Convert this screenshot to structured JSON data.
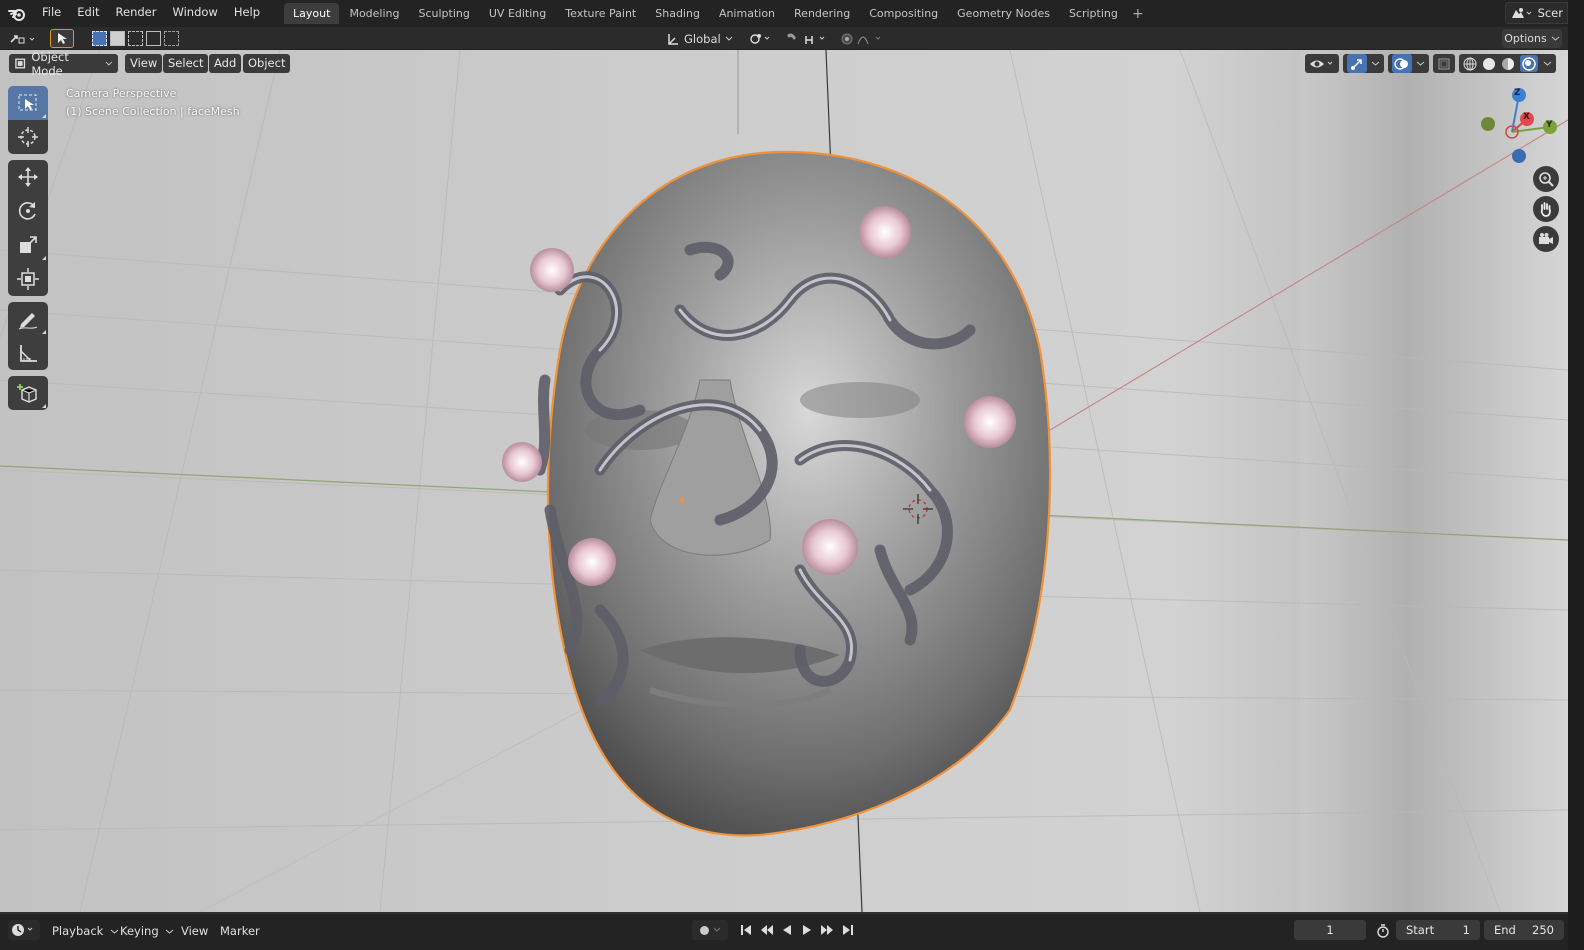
{
  "topbar": {
    "menus": [
      "File",
      "Edit",
      "Render",
      "Window",
      "Help"
    ],
    "workspaces": [
      "Layout",
      "Modeling",
      "Sculpting",
      "UV Editing",
      "Texture Paint",
      "Shading",
      "Animation",
      "Rendering",
      "Compositing",
      "Geometry Nodes",
      "Scripting"
    ],
    "active_workspace": "Layout",
    "scene_label": "Scer"
  },
  "header": {
    "orientation": "Global",
    "options": "Options"
  },
  "viewport": {
    "mode": "Object Mode",
    "menus": [
      "View",
      "Select",
      "Add",
      "Object"
    ],
    "info_line1": "Camera Perspective",
    "info_line2": "(1) Scene Collection | faceMesh",
    "axes": {
      "z": "Z",
      "x": "X",
      "y": "Y"
    },
    "colors": {
      "selection_outline": "#f0923a",
      "active_tool": "#5676a5",
      "x_axis": "#cc4a4a",
      "y_axis": "#7ba23a",
      "z_axis": "#3f7fd0"
    }
  },
  "tools": [
    "select-box",
    "cursor",
    "move",
    "rotate",
    "scale",
    "transform",
    "annotate",
    "measure",
    "add-cube"
  ],
  "timeline": {
    "playback": "Playback",
    "keying": "Keying",
    "view": "View",
    "marker": "Marker",
    "current_frame": "1",
    "start_label": "Start",
    "start": "1",
    "end_label": "End",
    "end": "250"
  }
}
